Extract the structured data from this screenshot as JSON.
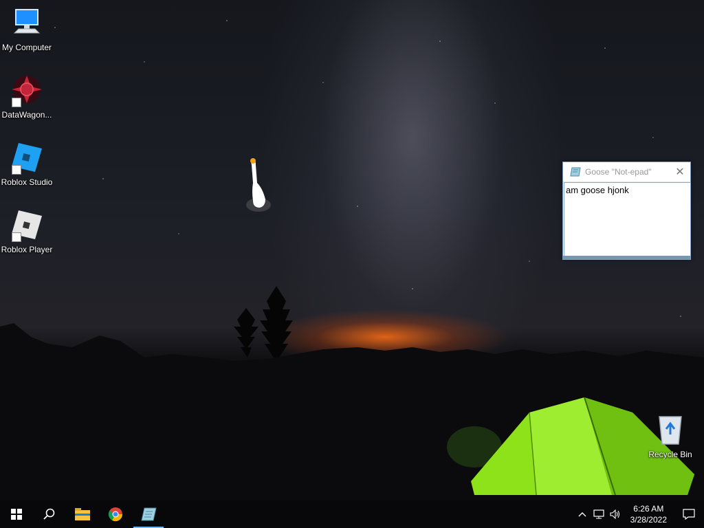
{
  "desktop_icons": [
    {
      "label": "My Computer",
      "icon": "computer-icon"
    },
    {
      "label": "DataWagon...",
      "icon": "datawagon-icon"
    },
    {
      "label": "Roblox Studio",
      "icon": "roblox-studio-icon"
    },
    {
      "label": "Roblox Player",
      "icon": "roblox-player-icon"
    },
    {
      "label": "Recycle Bin",
      "icon": "recycle-bin-icon"
    }
  ],
  "notepad": {
    "title": "Goose \"Not-epad\"",
    "content": "am goose hjonk"
  },
  "taskbar": {
    "buttons": [
      "start-icon",
      "search-icon",
      "file-explorer-icon",
      "chrome-icon",
      "notepad-icon"
    ],
    "time": "6:26 AM",
    "date": "3/28/2022"
  },
  "colors": {
    "taskbar_bg": "#08080a",
    "active_indicator": "#76b9ed",
    "tent_green": "#8ee21a"
  }
}
